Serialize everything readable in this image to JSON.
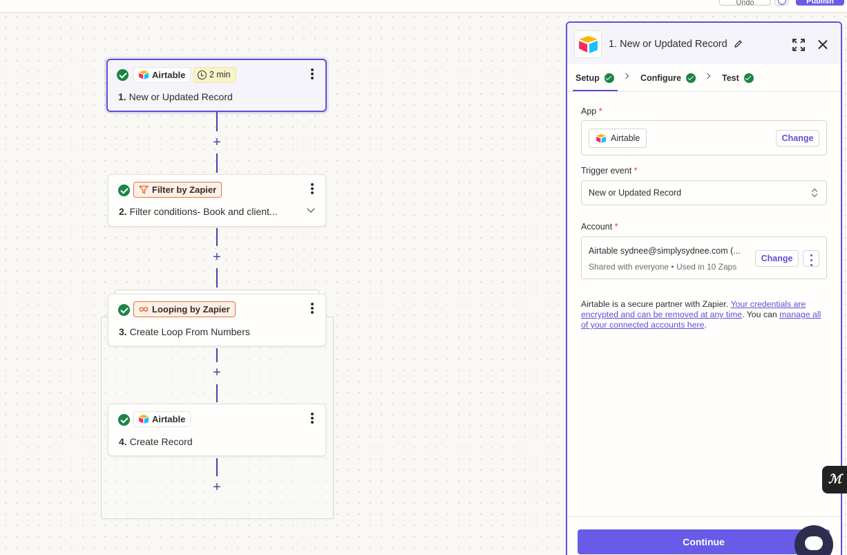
{
  "topbar": {
    "undo_label": "Undo",
    "publish_label": "Publish"
  },
  "steps": [
    {
      "app": "Airtable",
      "time": "2 min",
      "number": "1.",
      "title": "New or Updated Record"
    },
    {
      "app": "Filter by Zapier",
      "number": "2.",
      "title": "Filter conditions- Book and client..."
    },
    {
      "app": "Looping by Zapier",
      "number": "3.",
      "title": "Create Loop From Numbers"
    },
    {
      "app": "Airtable",
      "number": "4.",
      "title": "Create Record"
    }
  ],
  "panel": {
    "title": "1. New or Updated Record",
    "tabs": [
      "Setup",
      "Configure",
      "Test"
    ],
    "app_label": "App",
    "required_mark": "*",
    "app_name": "Airtable",
    "change_label": "Change",
    "trigger_label": "Trigger event",
    "trigger_value": "New or Updated Record",
    "account_label": "Account",
    "account_name": "Airtable sydnee@simplysydnee.com (...",
    "account_sub": "Shared with everyone • Used in 10 Zaps",
    "info_prefix": "Airtable is a secure partner with Zapier. ",
    "info_link1": "Your credentials are encrypted and can be removed at any time",
    "info_mid": ". You can ",
    "info_link2": "manage all of your connected accounts here",
    "info_suffix": ".",
    "continue_label": "Continue"
  },
  "colors": {
    "accent": "#5f4fd6",
    "success": "#1a8546",
    "filter_orange": "#e8713a",
    "button_primary": "#695be8"
  },
  "icons": [
    "airtable-logo-icon",
    "clock-icon",
    "filter-icon",
    "loop-icon",
    "pencil-icon",
    "expand-icon",
    "close-icon",
    "check-icon",
    "chevron-right-icon",
    "chevron-down-icon",
    "updown-icon",
    "kebab-icon",
    "chat-icon"
  ]
}
